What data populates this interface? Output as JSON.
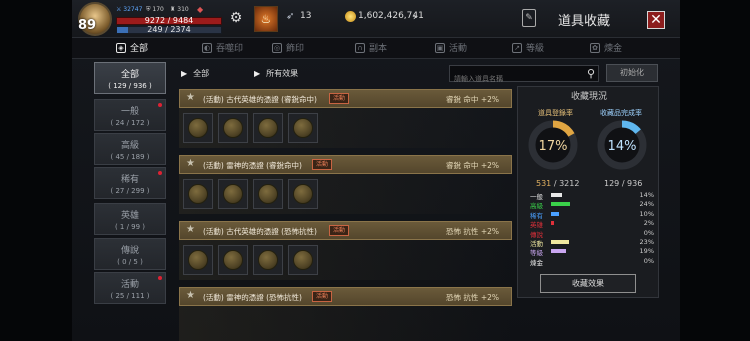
{
  "player": {
    "level": "89",
    "stat1": "32747",
    "stat2": "170",
    "stat3": "310",
    "hp": "9272 / 9484",
    "mp": "249 / 2374",
    "mp_fraction": 0.105
  },
  "header": {
    "feather_count": "13",
    "gold": "1,602,426,741",
    "title": "道具收藏",
    "close": "✕"
  },
  "tabs": [
    {
      "label": "全部",
      "icon": "all-icon"
    },
    {
      "label": "吞噬印",
      "icon": "seal-icon"
    },
    {
      "label": "飾印",
      "icon": "ornament-icon"
    },
    {
      "label": "副本",
      "icon": "dungeon-icon"
    },
    {
      "label": "活動",
      "icon": "event-icon"
    },
    {
      "label": "等級",
      "icon": "level-icon"
    },
    {
      "label": "煉金",
      "icon": "alchemy-icon"
    }
  ],
  "grades": [
    {
      "label": "全部",
      "count": "( 129 / 936 )",
      "active": true
    },
    {
      "label": "一般",
      "count": "( 24 / 172 )",
      "dot": true
    },
    {
      "label": "高級",
      "count": "( 45 / 189 )"
    },
    {
      "label": "稀有",
      "count": "( 27 / 299 )",
      "dot": true
    },
    {
      "label": "英雄",
      "count": "( 1 / 99 )"
    },
    {
      "label": "傳說",
      "count": "( 0 / 5 )"
    },
    {
      "label": "活動",
      "count": "( 25 / 111 )",
      "dot": true
    }
  ],
  "filter": {
    "crumb1": "全部",
    "crumb2": "所有效果",
    "search_placeholder": "請輸入道具名稱",
    "reset": "初始化"
  },
  "entries": [
    {
      "name": "(活動) 古代英雄的憑證 (睿銳命中)",
      "tag": "活動",
      "effect": "睿銳 命中 +2%"
    },
    {
      "name": "(活動) 雷神的憑證 (睿銳命中)",
      "tag": "活動",
      "effect": "睿銳 命中 +2%"
    },
    {
      "name": "(活動) 古代英雄的憑證 (恐怖抗性)",
      "tag": "活動",
      "effect": "恐怖 抗性 +2%"
    },
    {
      "name": "(活動) 雷神的憑證 (恐怖抗性)",
      "tag": "活動",
      "effect": "恐怖 抗性 +2%"
    }
  ],
  "status": {
    "title": "收藏現況",
    "reg_label": "道具登錄率",
    "comp_label": "收藏品完成率",
    "reg_pct": "17%",
    "comp_pct": "14%",
    "reg_fraction": 0.17,
    "comp_fraction": 0.14,
    "reg_count_a": "531",
    "reg_count_b": " / 3212",
    "comp_count": "129 / 936",
    "legend": [
      {
        "label": "一般",
        "pct": "14%",
        "color": "#e8e8e8",
        "fraction": 0.14
      },
      {
        "label": "高級",
        "pct": "24%",
        "color": "#3ad14a",
        "fraction": 0.24
      },
      {
        "label": "稀有",
        "pct": "10%",
        "color": "#4aa0ff",
        "fraction": 0.1
      },
      {
        "label": "英雄",
        "pct": "2%",
        "color": "#e0303a",
        "fraction": 0.02
      },
      {
        "label": "傳說",
        "pct": "0%",
        "color": "#e0303a",
        "fraction": 0.0
      },
      {
        "label": "活動",
        "pct": "23%",
        "color": "#f0e8a0",
        "fraction": 0.23
      },
      {
        "label": "等級",
        "pct": "19%",
        "color": "#c9a6f0",
        "fraction": 0.19
      },
      {
        "label": "煉金",
        "pct": "0%",
        "color": "#e8e8e8",
        "fraction": 0.0
      }
    ],
    "effect_button": "收藏效果"
  }
}
